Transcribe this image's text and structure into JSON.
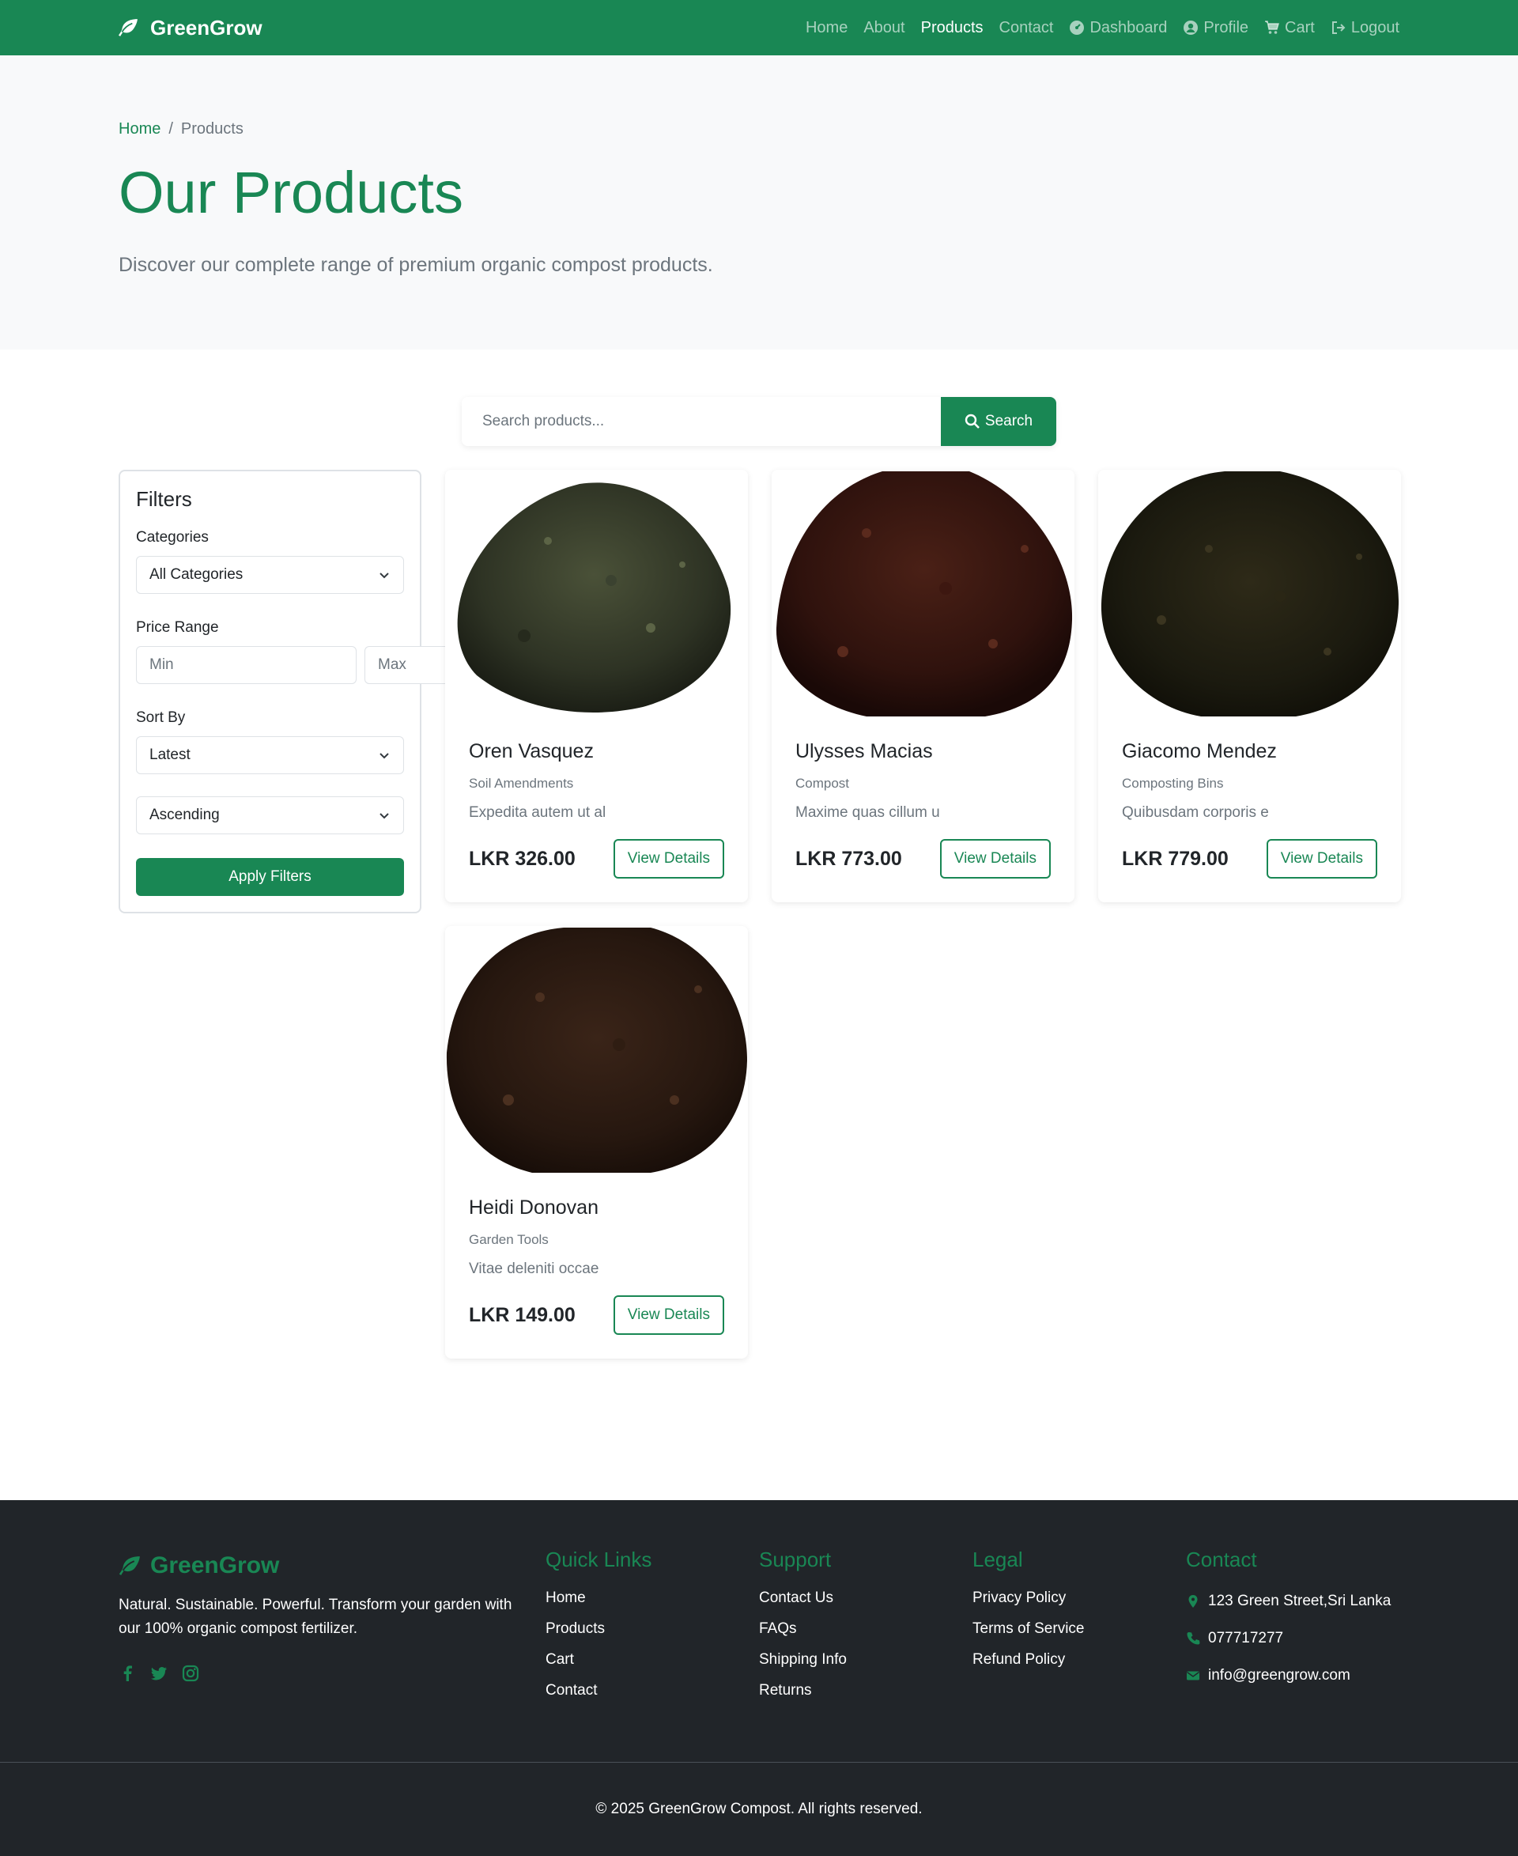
{
  "nav": {
    "brand": "GreenGrow",
    "links": [
      {
        "label": "Home"
      },
      {
        "label": "About"
      },
      {
        "label": "Products"
      },
      {
        "label": "Contact"
      },
      {
        "label": "Dashboard"
      },
      {
        "label": "Profile"
      },
      {
        "label": "Cart"
      },
      {
        "label": "Logout"
      }
    ]
  },
  "breadcrumb": {
    "home": "Home",
    "separator": "/",
    "current": "Products"
  },
  "hero": {
    "title": "Our Products",
    "subtitle": "Discover our complete range of premium organic compost products."
  },
  "search": {
    "placeholder": "Search products...",
    "button": "Search"
  },
  "filters": {
    "title": "Filters",
    "categories_label": "Categories",
    "categories_value": "All Categories",
    "price_label": "Price Range",
    "min_placeholder": "Min",
    "max_placeholder": "Max",
    "sort_label": "Sort By",
    "sort_value": "Latest",
    "order_value": "Ascending",
    "apply": "Apply Filters"
  },
  "products": [
    {
      "name": "Oren Vasquez",
      "category": "Soil Amendments",
      "desc": "Expedita autem ut al",
      "price": "LKR 326.00",
      "button": "View Details"
    },
    {
      "name": "Ulysses Macias",
      "category": "Compost",
      "desc": "Maxime quas cillum u",
      "price": "LKR 773.00",
      "button": "View Details"
    },
    {
      "name": "Giacomo Mendez",
      "category": "Composting Bins",
      "desc": "Quibusdam corporis e",
      "price": "LKR 779.00",
      "button": "View Details"
    },
    {
      "name": "Heidi Donovan",
      "category": "Garden Tools",
      "desc": "Vitae deleniti occae",
      "price": "LKR 149.00",
      "button": "View Details"
    }
  ],
  "footer": {
    "brand": "GreenGrow",
    "about": "Natural. Sustainable. Powerful. Transform your garden with our 100% organic compost fertilizer.",
    "quick_links": {
      "title": "Quick Links",
      "items": [
        "Home",
        "Products",
        "Cart",
        "Contact"
      ]
    },
    "support": {
      "title": "Support",
      "items": [
        "Contact Us",
        "FAQs",
        "Shipping Info",
        "Returns"
      ]
    },
    "legal": {
      "title": "Legal",
      "items": [
        "Privacy Policy",
        "Terms of Service",
        "Refund Policy"
      ]
    },
    "contact": {
      "title": "Contact",
      "address": "123 Green Street,Sri Lanka",
      "phone": "077717277",
      "email": "info@greengrow.com"
    },
    "copyright": "© 2025 GreenGrow Compost. All rights reserved."
  },
  "colors": {
    "primary": "#198754",
    "dark": "#212529",
    "light": "#f8f9fa"
  },
  "icons": [
    "leaf-icon",
    "dashboard-icon",
    "profile-icon",
    "cart-icon",
    "logout-icon",
    "search-icon",
    "chevron-down-icon",
    "facebook-icon",
    "twitter-icon",
    "instagram-icon",
    "map-pin-icon",
    "phone-icon",
    "envelope-icon"
  ]
}
